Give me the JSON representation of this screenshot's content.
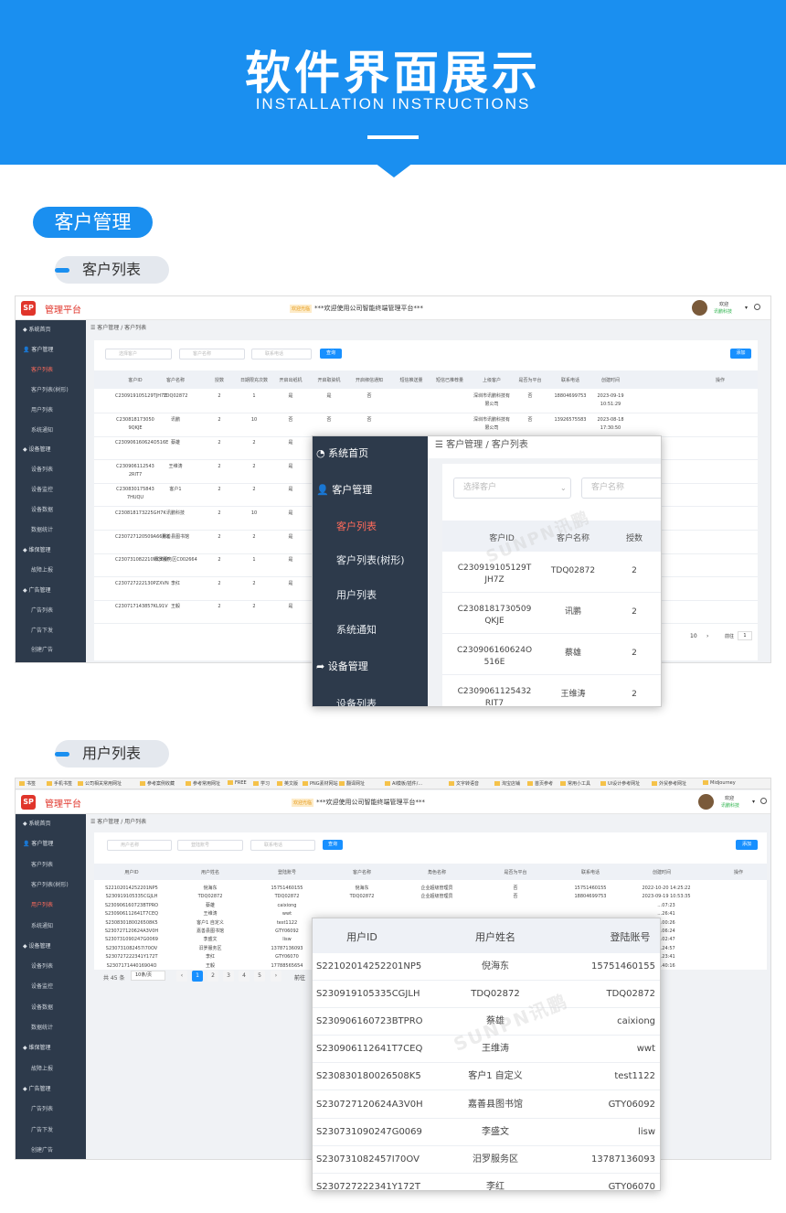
{
  "banner": {
    "title": "软件界面展示",
    "subtitle": "INSTALLATION INSTRUCTIONS"
  },
  "section": {
    "title": "客户管理",
    "sub1": "客户列表",
    "sub2": "用户列表"
  },
  "app": {
    "brand": "管理平台",
    "logo": "SP",
    "welcome_tag": "欢迎光临",
    "marquee": "***欢迎使用公司智能终端管理平台***",
    "user_name": "欢迎",
    "user_company": "讯鹏科技"
  },
  "sidebar": {
    "items": [
      {
        "label": "系统首页",
        "type": "group"
      },
      {
        "label": "客户管理",
        "type": "group"
      },
      {
        "label": "客户列表",
        "type": "sub",
        "active_in": 1
      },
      {
        "label": "客户列表(树形)",
        "type": "sub"
      },
      {
        "label": "用户列表",
        "type": "sub",
        "active_in": 2
      },
      {
        "label": "系统通知",
        "type": "sub"
      },
      {
        "label": "设备管理",
        "type": "group"
      },
      {
        "label": "设备列表",
        "type": "sub"
      },
      {
        "label": "设备监控",
        "type": "sub"
      },
      {
        "label": "设备数据",
        "type": "sub"
      },
      {
        "label": "数据统计",
        "type": "sub"
      },
      {
        "label": "维保管理",
        "type": "group"
      },
      {
        "label": "故障上报",
        "type": "sub"
      },
      {
        "label": "广告管理",
        "type": "group"
      },
      {
        "label": "广告列表",
        "type": "sub"
      },
      {
        "label": "广告下发",
        "type": "sub"
      },
      {
        "label": "创建广告",
        "type": "sub"
      }
    ]
  },
  "customers": {
    "breadcrumb": [
      "客户管理",
      "客户列表"
    ],
    "filters": [
      "选择客户",
      "客户名称",
      "联系电话"
    ],
    "search_btn": "查询",
    "add_btn": "添加",
    "columns": [
      "客户ID",
      "客户名称",
      "授数",
      "日期限充次数",
      "开启出纸机",
      "开启取染机",
      "开启绑信通知",
      "短信推送量",
      "短信已推荐量",
      "上级客户",
      "是否为平台",
      "联系电话",
      "创建时间",
      "操作"
    ],
    "rows": [
      {
        "id": "C230919105129TJH7Z",
        "name": "TDQ02872",
        "n": "2",
        "d": "1",
        "a": "是",
        "b": "是",
        "c": "否",
        "parent": "深圳市讯鹏科技有限公司",
        "platform": "否",
        "phone": "18804699753",
        "time": "2023-09-19 10:51:29"
      },
      {
        "id": "C230818173050 9QKJE",
        "name": "讯鹏",
        "n": "2",
        "d": "10",
        "a": "否",
        "b": "否",
        "c": "否",
        "parent": "深圳市讯鹏科技有限公司",
        "platform": "否",
        "phone": "13926575583",
        "time": "2023-08-18 17:30:50"
      },
      {
        "id": "C230906160624O516E",
        "name": "蔡雄",
        "n": "2",
        "d": "2",
        "a": "是",
        "b": "",
        "c": "",
        "parent": "",
        "platform": "",
        "phone": "",
        "time": "…06 16:0…24"
      },
      {
        "id": "C230906112543 2RIT7",
        "name": "王维涛",
        "n": "2",
        "d": "2",
        "a": "是",
        "b": "",
        "c": "",
        "parent": "",
        "platform": "",
        "phone": "",
        "time": "…06 11:2…43"
      },
      {
        "id": "C230830175843 7HUQU",
        "name": "客户1",
        "n": "2",
        "d": "2",
        "a": "是",
        "b": "",
        "c": "",
        "parent": "",
        "platform": "",
        "phone": "",
        "time": "…30 17:5…43"
      },
      {
        "id": "C230818173225GH7K",
        "name": "讯鹏科技",
        "n": "2",
        "d": "10",
        "a": "是",
        "b": "",
        "c": "",
        "parent": "",
        "platform": "",
        "phone": "",
        "time": "…18 17:3…25"
      },
      {
        "id": "C230727120509A66MX",
        "name": "嘉善县图书馆",
        "n": "2",
        "d": "2",
        "a": "是",
        "b": "",
        "c": "",
        "parent": "",
        "platform": "",
        "phone": "",
        "time": "…27 12:0…09"
      },
      {
        "id": "C230731082210MCD6F",
        "name": "汨罗服务区C002664",
        "n": "2",
        "d": "1",
        "a": "是",
        "b": "",
        "c": "",
        "parent": "",
        "platform": "",
        "phone": "",
        "time": "…31 08:2…10"
      },
      {
        "id": "C230727222130PZXVN",
        "name": "李红",
        "n": "2",
        "d": "2",
        "a": "是",
        "b": "",
        "c": "",
        "parent": "",
        "platform": "",
        "phone": "",
        "time": "…27 22:2…30"
      },
      {
        "id": "C230717143857KL91V",
        "name": "王毅",
        "n": "2",
        "d": "2",
        "a": "是",
        "b": "",
        "c": "",
        "parent": "",
        "platform": "",
        "phone": "",
        "time": "…17 14:3…57"
      }
    ],
    "pager": {
      "last": "10",
      "goto": "前往",
      "page": "1",
      "unit": "页"
    }
  },
  "popup1": {
    "sidebar": [
      {
        "label": "系统首页",
        "icon": "dashboard-icon"
      },
      {
        "label": "客户管理",
        "icon": "user-icon"
      },
      {
        "label": "客户列表"
      },
      {
        "label": "客户列表(树形)"
      },
      {
        "label": "用户列表"
      },
      {
        "label": "系统通知"
      },
      {
        "label": "设备管理",
        "icon": "share-icon"
      },
      {
        "label": "设备列表"
      }
    ],
    "breadcrumb": [
      "客户管理",
      "客户列表"
    ],
    "filters": [
      "选择客户",
      "客户名称"
    ],
    "columns": [
      "客户ID",
      "客户名称",
      "授数"
    ],
    "rows": [
      {
        "id1": "C230919105129T",
        "id2": "JH7Z",
        "name": "TDQ02872",
        "n": "2"
      },
      {
        "id1": "C2308181730509",
        "id2": "QKJE",
        "name": "讯鹏",
        "n": "2"
      },
      {
        "id1": "C230906160624O",
        "id2": "516E",
        "name": "蔡雄",
        "n": "2"
      },
      {
        "id1": "C2309061125432",
        "id2": "RIT7",
        "name": "王维涛",
        "n": "2"
      }
    ],
    "watermark": "SUNPN讯鹏"
  },
  "bookmarks": [
    "书签",
    "手机书签",
    "公司相关常用网址",
    "参考案例收藏",
    "参考常用网址",
    "FREE",
    "学习",
    "英文版",
    "PNG素材网站",
    "翻译网址",
    "AI模板/插件/…",
    "文字转语音",
    "淘宝店铺",
    "首页参考",
    "常用小工具",
    "UI设计参考网址",
    "外贸参考网址",
    "Midjourney"
  ],
  "users": {
    "breadcrumb": [
      "客户管理",
      "用户列表"
    ],
    "filters": [
      "用户名称",
      "登陆账号",
      "联系电话"
    ],
    "search_btn": "查询",
    "add_btn": "添加",
    "columns": [
      "用户ID",
      "用户姓名",
      "登陆账号",
      "客户名称",
      "角色名称",
      "是否为平台",
      "联系电话",
      "创建时间",
      "操作"
    ],
    "rows": [
      {
        "id": "S22102014252201NP5",
        "name": "倪海东",
        "account": "15751460155",
        "cust": "倪海东",
        "role": "企业超级管理员",
        "platform": "否",
        "phone": "15751460155",
        "time": "2022-10-20 14:25:22"
      },
      {
        "id": "S230919105335CGJLH",
        "name": "TDQ02872",
        "account": "TDQ02872",
        "cust": "TDQ02872",
        "role": "企业超级管理员",
        "platform": "否",
        "phone": "18804699753",
        "time": "2023-09-19 10:53:35"
      },
      {
        "id": "S230906160723BTPRO",
        "name": "蔡雄",
        "account": "caixiong",
        "cust": "",
        "role": "",
        "platform": "",
        "phone": "",
        "time": "…07:23"
      },
      {
        "id": "S230906112641T7CEQ",
        "name": "王维涛",
        "account": "wwt",
        "cust": "",
        "role": "",
        "platform": "",
        "phone": "",
        "time": "…26:41"
      },
      {
        "id": "S230830180026508K5",
        "name": "客户1 自定义",
        "account": "test1122",
        "cust": "",
        "role": "",
        "platform": "",
        "phone": "",
        "time": "…00:26"
      },
      {
        "id": "S230727120624A3V0H",
        "name": "嘉善县图书馆",
        "account": "GTY06092",
        "cust": "",
        "role": "",
        "platform": "",
        "phone": "",
        "time": "…06:24"
      },
      {
        "id": "S230731090247G0069",
        "name": "李盛文",
        "account": "lisw",
        "cust": "",
        "role": "",
        "platform": "",
        "phone": "",
        "time": "…02:47"
      },
      {
        "id": "S230731082457I70OV",
        "name": "汨罗服务区",
        "account": "13787136093",
        "cust": "",
        "role": "",
        "platform": "",
        "phone": "",
        "time": "…24:57"
      },
      {
        "id": "S230727222341Y172T",
        "name": "李红",
        "account": "GTY06070",
        "cust": "",
        "role": "",
        "platform": "",
        "phone": "",
        "time": "…23:41"
      },
      {
        "id": "S230717144016904O",
        "name": "王毅",
        "account": "17788565654",
        "cust": "",
        "role": "",
        "platform": "",
        "phone": "",
        "time": "…40:16"
      }
    ],
    "pager": {
      "total": "共 45 条",
      "size": "10条/页",
      "pages": [
        "1",
        "2",
        "3",
        "4",
        "5"
      ],
      "goto": "前往"
    }
  },
  "popup2": {
    "columns": [
      "用户ID",
      "用户姓名",
      "登陆账号"
    ],
    "rows": [
      {
        "id": "S22102014252201NP5",
        "name": "倪海东",
        "account": "15751460155"
      },
      {
        "id": "S230919105335CGJLH",
        "name": "TDQ02872",
        "account": "TDQ02872"
      },
      {
        "id": "S230906160723BTPRO",
        "name": "蔡雄",
        "account": "caixiong"
      },
      {
        "id": "S230906112641T7CEQ",
        "name": "王维涛",
        "account": "wwt"
      },
      {
        "id": "S230830180026508K5",
        "name": "客户1 自定义",
        "account": "test1122"
      },
      {
        "id": "S230727120624A3V0H",
        "name": "嘉善县图书馆",
        "account": "GTY06092"
      },
      {
        "id": "S230731090247G0069",
        "name": "李盛文",
        "account": "lisw"
      },
      {
        "id": "S230731082457I70OV",
        "name": "汨罗服务区",
        "account": "13787136093"
      },
      {
        "id": "S230727222341Y172T",
        "name": "李红",
        "account": "GTY06070"
      }
    ],
    "watermark": "SUNPN讯鹏"
  }
}
